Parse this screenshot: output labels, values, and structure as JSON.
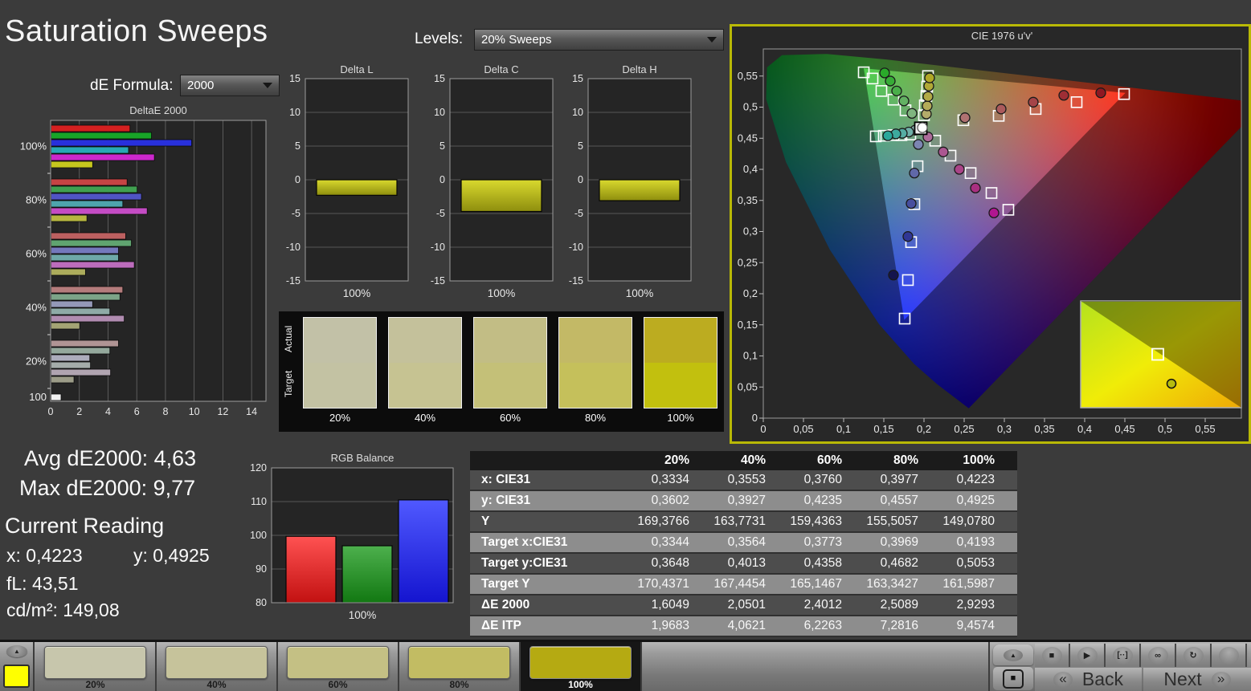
{
  "header": {
    "title": "Saturation Sweeps",
    "de_formula_label": "dE Formula:",
    "de_formula_value": "2000",
    "levels_label": "Levels:",
    "levels_value": "20% Sweeps"
  },
  "stats": {
    "avg": "Avg dE2000: 4,63",
    "max": "Max dE2000: 9,77",
    "current_reading": "Current Reading",
    "x": "x: 0,4223",
    "y": "y: 0,4925",
    "fl": "fL: 43,51",
    "cdm2": "cd/m²: 149,08"
  },
  "patches": {
    "actual_label": "Actual",
    "target_label": "Target",
    "items": [
      {
        "label": "20%",
        "actual": "#c2c1a7",
        "target": "#c3c2a3"
      },
      {
        "label": "40%",
        "actual": "#c4c19b",
        "target": "#c6c392"
      },
      {
        "label": "60%",
        "actual": "#c2bd85",
        "target": "#c4c078"
      },
      {
        "label": "80%",
        "actual": "#c3b966",
        "target": "#c5c05b"
      },
      {
        "label": "100%",
        "actual": "#bcac20",
        "target": "#c2c00e"
      }
    ]
  },
  "table": {
    "columns": [
      "20%",
      "40%",
      "60%",
      "80%",
      "100%"
    ],
    "rows": [
      {
        "label": "x: CIE31",
        "values": [
          "0,3334",
          "0,3553",
          "0,3760",
          "0,3977",
          "0,4223"
        ]
      },
      {
        "label": "y: CIE31",
        "values": [
          "0,3602",
          "0,3927",
          "0,4235",
          "0,4557",
          "0,4925"
        ]
      },
      {
        "label": "Y",
        "values": [
          "169,3766",
          "163,7731",
          "159,4363",
          "155,5057",
          "149,0780"
        ]
      },
      {
        "label": "Target x:CIE31",
        "values": [
          "0,3344",
          "0,3564",
          "0,3773",
          "0,3969",
          "0,4193"
        ]
      },
      {
        "label": "Target y:CIE31",
        "values": [
          "0,3648",
          "0,4013",
          "0,4358",
          "0,4682",
          "0,5053"
        ]
      },
      {
        "label": "Target Y",
        "values": [
          "170,4371",
          "167,4454",
          "165,1467",
          "163,3427",
          "161,5987"
        ]
      },
      {
        "label": "ΔE 2000",
        "values": [
          "1,6049",
          "2,0501",
          "2,4012",
          "2,5089",
          "2,9293"
        ]
      },
      {
        "label": "ΔE ITP",
        "values": [
          "1,9683",
          "4,0621",
          "6,2263",
          "7,2816",
          "9,4574"
        ]
      }
    ]
  },
  "footer": {
    "tabs": [
      {
        "label": "20%",
        "color": "#c7c6ac",
        "selected": false
      },
      {
        "label": "40%",
        "color": "#c6c39b",
        "selected": false
      },
      {
        "label": "60%",
        "color": "#c4c084",
        "selected": false
      },
      {
        "label": "80%",
        "color": "#c2bc63",
        "selected": false
      },
      {
        "label": "100%",
        "color": "#b5aa12",
        "selected": true
      }
    ],
    "up_arrow": "▲",
    "stop_big": "■",
    "icon_cells": [
      {
        "name": "stop-icon",
        "glyph": "■"
      },
      {
        "name": "play-icon",
        "glyph": "▶"
      },
      {
        "name": "bracket-icon",
        "glyph": "[··]"
      },
      {
        "name": "loop-icon",
        "glyph": "∞"
      },
      {
        "name": "refresh-icon",
        "glyph": "↻"
      },
      {
        "name": "blank-button",
        "glyph": ""
      }
    ],
    "back": "Back",
    "next": "Next",
    "back_arrow": "«",
    "next_arrow": "»"
  },
  "chart_data": [
    {
      "id": "deltae2000",
      "type": "bar",
      "orientation": "horizontal",
      "title": "DeltaE 2000",
      "xlim": [
        0,
        15
      ],
      "xticks": [
        0,
        2,
        4,
        6,
        8,
        10,
        12,
        14
      ],
      "series_names": [
        "Red",
        "Green",
        "Blue",
        "Cyan",
        "Magenta",
        "Yellow"
      ],
      "groups": [
        {
          "label": "100%",
          "values": [
            5.5,
            7.0,
            9.8,
            5.4,
            7.2,
            2.9
          ],
          "colors": [
            "#d42020",
            "#18a428",
            "#2830dc",
            "#28a8b4",
            "#cc28cc",
            "#c6c61e"
          ]
        },
        {
          "label": "80%",
          "values": [
            5.3,
            6.0,
            6.3,
            5.0,
            6.7,
            2.5
          ],
          "colors": [
            "#c64444",
            "#40a050",
            "#5054c4",
            "#4ea4ac",
            "#c44cc4",
            "#b6b640"
          ]
        },
        {
          "label": "60%",
          "values": [
            5.2,
            5.6,
            4.7,
            4.7,
            5.8,
            2.4
          ],
          "colors": [
            "#bc6060",
            "#60a470",
            "#7478bc",
            "#6ea8a8",
            "#bc6cbc",
            "#acac5c"
          ]
        },
        {
          "label": "40%",
          "values": [
            5.0,
            4.8,
            2.9,
            4.1,
            5.1,
            2.0
          ],
          "colors": [
            "#b47c7c",
            "#7ca488",
            "#9498b8",
            "#8eaaa6",
            "#b08cb0",
            "#a4a474"
          ]
        },
        {
          "label": "20%",
          "values": [
            4.7,
            4.1,
            2.7,
            2.75,
            4.15,
            1.6
          ],
          "colors": [
            "#b09494",
            "#94a89c",
            "#acacbc",
            "#a4acaa",
            "#b0a4b0",
            "#9c9c88"
          ]
        },
        {
          "label": "100",
          "values": [
            0.7
          ],
          "colors": [
            "#f2f2f2"
          ]
        }
      ]
    },
    {
      "id": "delta_l",
      "type": "bar",
      "title": "Delta L",
      "categories": [
        "100%"
      ],
      "values": [
        -2.3
      ],
      "ylim": [
        -15,
        15
      ],
      "ytick_step": 5
    },
    {
      "id": "delta_c",
      "type": "bar",
      "title": "Delta C",
      "categories": [
        "100%"
      ],
      "values": [
        -4.7
      ],
      "ylim": [
        -15,
        15
      ],
      "ytick_step": 5
    },
    {
      "id": "delta_h",
      "type": "bar",
      "title": "Delta H",
      "categories": [
        "100%"
      ],
      "values": [
        -3.1
      ],
      "ylim": [
        -15,
        15
      ],
      "ytick_step": 5
    },
    {
      "id": "rgb_balance",
      "type": "bar",
      "title": "RGB Balance",
      "categories": [
        "100%"
      ],
      "ylim": [
        80,
        120
      ],
      "ytick_step": 10,
      "series": [
        {
          "name": "Red",
          "values": [
            99.7
          ]
        },
        {
          "name": "Green",
          "values": [
            96.9
          ]
        },
        {
          "name": "Blue",
          "values": [
            110.5
          ]
        }
      ]
    },
    {
      "id": "cie1976",
      "type": "scatter",
      "title": "CIE 1976 u'v'",
      "axis": {
        "xmin": 0,
        "xmax": 0.595,
        "ymin": 0,
        "ymax": 0.593,
        "tick_step": 0.05,
        "tick_labels": [
          "0",
          "0,05",
          "0,1",
          "0,15",
          "0,2",
          "0,25",
          "0,3",
          "0,35",
          "0,4",
          "0,45",
          "0,5",
          "0,55"
        ]
      },
      "families": [
        {
          "name": "green",
          "squares": [
            [
              0.177,
              0.495
            ],
            [
              0.162,
              0.512
            ],
            [
              0.147,
              0.526
            ],
            [
              0.136,
              0.546
            ],
            [
              0.125,
              0.556
            ]
          ],
          "circles": [
            [
              0.185,
              0.49
            ],
            [
              0.175,
              0.51
            ],
            [
              0.166,
              0.526
            ],
            [
              0.158,
              0.542
            ],
            [
              0.151,
              0.555
            ]
          ],
          "circle_colors": [
            "#7fb57f",
            "#63b163",
            "#4aae4a",
            "#37ac37",
            "#2aaa2a"
          ]
        },
        {
          "name": "yellow",
          "squares": [
            [
              0.2,
              0.487
            ],
            [
              0.201,
              0.503
            ],
            [
              0.203,
              0.518
            ],
            [
              0.204,
              0.533
            ],
            [
              0.205,
              0.55
            ]
          ],
          "circles": [
            [
              0.203,
              0.489
            ],
            [
              0.204,
              0.502
            ],
            [
              0.205,
              0.517
            ],
            [
              0.206,
              0.534
            ],
            [
              0.207,
              0.547
            ]
          ],
          "circle_colors": [
            "#b3ac6a",
            "#b3ab58",
            "#b2aa46",
            "#b1a936",
            "#b0a726"
          ]
        },
        {
          "name": "cyan",
          "squares": [
            [
              0.183,
              0.456
            ],
            [
              0.172,
              0.455
            ],
            [
              0.162,
              0.455
            ],
            [
              0.15,
              0.454
            ],
            [
              0.14,
              0.453
            ]
          ],
          "circles": [
            [
              0.189,
              0.463
            ],
            [
              0.181,
              0.46
            ],
            [
              0.173,
              0.458
            ],
            [
              0.165,
              0.457
            ],
            [
              0.155,
              0.454
            ]
          ],
          "circle_colors": [
            "#8ab2ac",
            "#6fb0a8",
            "#55ada3",
            "#3daa9e",
            "#2aa79a"
          ]
        },
        {
          "name": "red",
          "squares": [
            [
              0.249,
              0.479
            ],
            [
              0.293,
              0.486
            ],
            [
              0.339,
              0.497
            ],
            [
              0.39,
              0.508
            ],
            [
              0.449,
              0.521
            ]
          ],
          "circles": [
            [
              0.251,
              0.483
            ],
            [
              0.296,
              0.497
            ],
            [
              0.336,
              0.508
            ],
            [
              0.374,
              0.519
            ],
            [
              0.42,
              0.523
            ]
          ],
          "circle_colors": [
            "#b07272",
            "#ab5a5c",
            "#a54448",
            "#9e2e35",
            "#8f1822"
          ]
        },
        {
          "name": "magenta",
          "squares": [
            [
              0.214,
              0.446
            ],
            [
              0.233,
              0.422
            ],
            [
              0.258,
              0.394
            ],
            [
              0.284,
              0.362
            ],
            [
              0.305,
              0.335
            ]
          ],
          "circles": [
            [
              0.205,
              0.452
            ],
            [
              0.224,
              0.428
            ],
            [
              0.244,
              0.4
            ],
            [
              0.264,
              0.37
            ],
            [
              0.287,
              0.33
            ]
          ],
          "circle_colors": [
            "#ad6b9a",
            "#ab5791",
            "#aa4488",
            "#a92f80",
            "#b01690"
          ]
        },
        {
          "name": "blue",
          "squares": [
            [
              0.192,
              0.405
            ],
            [
              0.188,
              0.344
            ],
            [
              0.184,
              0.283
            ],
            [
              0.18,
              0.222
            ],
            [
              0.176,
              0.16
            ]
          ],
          "circles": [
            [
              0.193,
              0.44
            ],
            [
              0.188,
              0.394
            ],
            [
              0.184,
              0.345
            ],
            [
              0.18,
              0.292
            ],
            [
              0.162,
              0.23
            ]
          ],
          "circle_colors": [
            "#7c85b2",
            "#6068a8",
            "#474e9e",
            "#303695",
            "#14144d"
          ]
        }
      ],
      "white_point": {
        "square": [
          0.196,
          0.466
        ],
        "circle": [
          0.198,
          0.467
        ]
      },
      "inset": {
        "square_rel": [
          0.48,
          0.5
        ],
        "circle_rel": [
          0.565,
          0.775
        ],
        "circle_color": "#b6bc10"
      }
    }
  ]
}
